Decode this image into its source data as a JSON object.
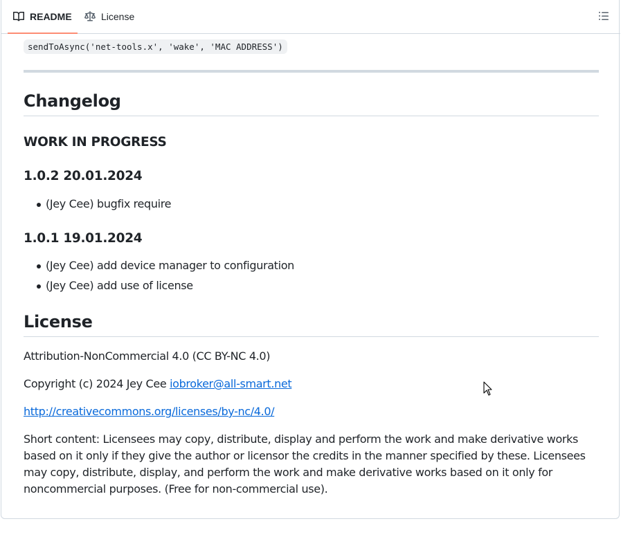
{
  "tabs": {
    "readme_label": "README",
    "license_label": "License"
  },
  "icons": {
    "readme": "book-icon",
    "license": "scale-balance-icon",
    "toc": "list-unordered-icon"
  },
  "colors": {
    "accent_underline": "#fd8c73",
    "link": "#0969da",
    "text": "#1f2328",
    "border": "#d1d9e0"
  },
  "content": {
    "code_line": "sendToAsync('net-tools.x', 'wake', 'MAC ADDRESS')",
    "changelog_heading": "Changelog",
    "wip_heading": "WORK IN PROGRESS",
    "v102_heading": "1.0.2 20.01.2024",
    "v102_items": [
      "(Jey Cee) bugfix require"
    ],
    "v101_heading": "1.0.1 19.01.2024",
    "v101_items": [
      "(Jey Cee) add device manager to configuration",
      "(Jey Cee) add use of license"
    ],
    "license_heading": "License",
    "license_name": "Attribution-NonCommercial 4.0 (CC BY-NC 4.0)",
    "copyright_prefix": "Copyright (c) 2024 Jey Cee ",
    "copyright_email": "iobroker@all-smart.net",
    "license_url": "http://creativecommons.org/licenses/by-nc/4.0/",
    "short_content": "Short content: Licensees may copy, distribute, display and perform the work and make derivative works based on it only if they give the author or licensor the credits in the manner specified by these. Licensees may copy, distribute, display, and perform the work and make derivative works based on it only for noncommercial purposes. (Free for non-commercial use)."
  }
}
